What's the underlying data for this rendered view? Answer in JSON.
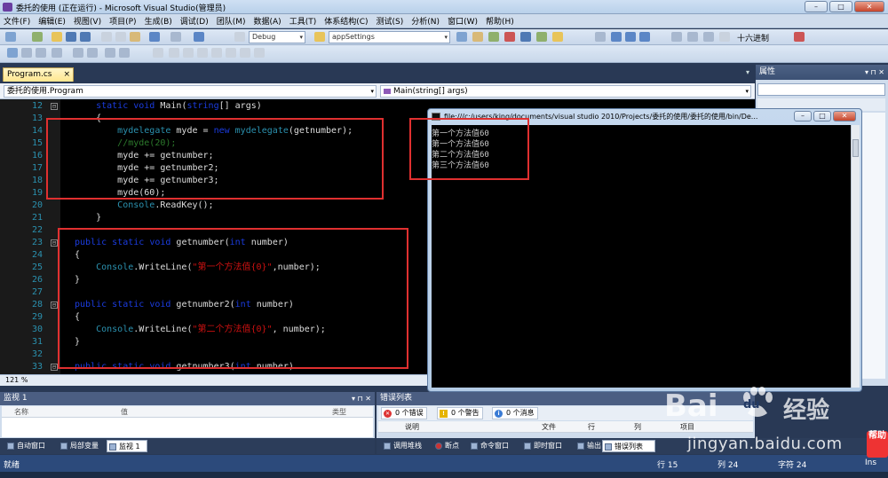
{
  "window": {
    "title": "委托的使用 (正在运行) - Microsoft Visual Studio(管理员)",
    "btn_min": "–",
    "btn_max": "□",
    "btn_close": "✕"
  },
  "menu": [
    "文件(F)",
    "编辑(E)",
    "视图(V)",
    "项目(P)",
    "生成(B)",
    "调试(D)",
    "团队(M)",
    "数据(A)",
    "工具(T)",
    "体系结构(C)",
    "测试(S)",
    "分析(N)",
    "窗口(W)",
    "帮助(H)"
  ],
  "toolbar": {
    "config": "Debug",
    "startup_item": "appSettings",
    "hex_label": "十六进制"
  },
  "editor": {
    "tab_label": "Program.cs",
    "tab_close": "×",
    "nav_class": "委托的使用.Program",
    "nav_method": "Main(string[] args)",
    "zoom": "121 %",
    "lines": [
      {
        "no": "12",
        "fold": "⊟",
        "tokens": [
          {
            "t": "kw",
            "v": "static "
          },
          {
            "t": "kw",
            "v": "void "
          },
          {
            "t": "pl",
            "v": "Main("
          },
          {
            "t": "kw",
            "v": "string"
          },
          {
            "t": "pl",
            "v": "[] args)"
          }
        ],
        "indent": "    "
      },
      {
        "no": "13",
        "fold": "",
        "tokens": [
          {
            "t": "pl",
            "v": "{"
          }
        ],
        "indent": "    "
      },
      {
        "no": "14",
        "fold": "",
        "tokens": [
          {
            "t": "ty",
            "v": "mydelegate"
          },
          {
            "t": "pl",
            "v": " myde = "
          },
          {
            "t": "kw",
            "v": "new "
          },
          {
            "t": "ty",
            "v": "mydelegate"
          },
          {
            "t": "pl",
            "v": "(getnumber);"
          }
        ],
        "indent": "        "
      },
      {
        "no": "15",
        "fold": "",
        "tokens": [
          {
            "t": "cm",
            "v": "//myde(20);"
          }
        ],
        "indent": "        "
      },
      {
        "no": "16",
        "fold": "",
        "tokens": [
          {
            "t": "pl",
            "v": "myde += getnumber;"
          }
        ],
        "indent": "        "
      },
      {
        "no": "17",
        "fold": "",
        "tokens": [
          {
            "t": "pl",
            "v": "myde += getnumber2;"
          }
        ],
        "indent": "        "
      },
      {
        "no": "18",
        "fold": "",
        "tokens": [
          {
            "t": "pl",
            "v": "myde += getnumber3;"
          }
        ],
        "indent": "        "
      },
      {
        "no": "19",
        "fold": "",
        "tokens": [
          {
            "t": "pl",
            "v": "myde(60);"
          }
        ],
        "indent": "        "
      },
      {
        "no": "20",
        "fold": "",
        "tokens": [
          {
            "t": "ty",
            "v": "Console"
          },
          {
            "t": "pl",
            "v": ".ReadKey();"
          }
        ],
        "indent": "        "
      },
      {
        "no": "21",
        "fold": "",
        "tokens": [
          {
            "t": "pl",
            "v": "}"
          }
        ],
        "indent": "    "
      },
      {
        "no": "22",
        "fold": "",
        "tokens": [],
        "indent": ""
      },
      {
        "no": "23",
        "fold": "⊟",
        "tokens": [
          {
            "t": "kw",
            "v": "public "
          },
          {
            "t": "kw",
            "v": "static "
          },
          {
            "t": "kw",
            "v": "void "
          },
          {
            "t": "pl",
            "v": "getnumber("
          },
          {
            "t": "kw",
            "v": "int "
          },
          {
            "t": "pl",
            "v": "number)"
          }
        ],
        "indent": ""
      },
      {
        "no": "24",
        "fold": "",
        "tokens": [
          {
            "t": "pl",
            "v": "{"
          }
        ],
        "indent": ""
      },
      {
        "no": "25",
        "fold": "",
        "tokens": [
          {
            "t": "ty",
            "v": "Console"
          },
          {
            "t": "pl",
            "v": ".WriteLine("
          },
          {
            "t": "str",
            "v": "\"第一个方法值{0}\""
          },
          {
            "t": "pl",
            "v": ",number);"
          }
        ],
        "indent": "    "
      },
      {
        "no": "26",
        "fold": "",
        "tokens": [
          {
            "t": "pl",
            "v": "}"
          }
        ],
        "indent": ""
      },
      {
        "no": "27",
        "fold": "",
        "tokens": [],
        "indent": ""
      },
      {
        "no": "28",
        "fold": "⊟",
        "tokens": [
          {
            "t": "kw",
            "v": "public "
          },
          {
            "t": "kw",
            "v": "static "
          },
          {
            "t": "kw",
            "v": "void "
          },
          {
            "t": "pl",
            "v": "getnumber2("
          },
          {
            "t": "kw",
            "v": "int "
          },
          {
            "t": "pl",
            "v": "number)"
          }
        ],
        "indent": ""
      },
      {
        "no": "29",
        "fold": "",
        "tokens": [
          {
            "t": "pl",
            "v": "{"
          }
        ],
        "indent": ""
      },
      {
        "no": "30",
        "fold": "",
        "tokens": [
          {
            "t": "ty",
            "v": "Console"
          },
          {
            "t": "pl",
            "v": ".WriteLine("
          },
          {
            "t": "str",
            "v": "\"第二个方法值{0}\""
          },
          {
            "t": "pl",
            "v": ", number);"
          }
        ],
        "indent": "    "
      },
      {
        "no": "31",
        "fold": "",
        "tokens": [
          {
            "t": "pl",
            "v": "}"
          }
        ],
        "indent": ""
      },
      {
        "no": "32",
        "fold": "",
        "tokens": [],
        "indent": ""
      },
      {
        "no": "33",
        "fold": "⊟",
        "tokens": [
          {
            "t": "kw",
            "v": "public "
          },
          {
            "t": "kw",
            "v": "static "
          },
          {
            "t": "kw",
            "v": "void "
          },
          {
            "t": "pl",
            "v": "getnumber3("
          },
          {
            "t": "kw",
            "v": "int "
          },
          {
            "t": "pl",
            "v": "number)"
          }
        ],
        "indent": ""
      }
    ]
  },
  "console": {
    "title": "file:///c:/users/king/documents/visual studio 2010/Projects/委托的使用/委托的使用/bin/De...",
    "lines": [
      "第一个方法值60",
      "第一个方法值60",
      "第二个方法值60",
      "第三个方法值60"
    ]
  },
  "properties": {
    "title": "属性",
    "btns": "▾ ⊓ ✕"
  },
  "watch": {
    "title": "监视 1",
    "btns": "▾ ⊓ ✕",
    "cols": [
      "名称",
      "值",
      "类型"
    ]
  },
  "errors": {
    "title": "错误列表",
    "errors_btn": "0 个错误",
    "warnings_btn": "0 个警告",
    "messages_btn": "0 个消息",
    "cols": [
      "说明",
      "文件",
      "行",
      "列",
      "项目"
    ]
  },
  "bottom_tabs_left": [
    "自动窗口",
    "局部变量",
    "监视 1"
  ],
  "bottom_tabs_right": [
    "调用堆栈",
    "断点",
    "命令窗口",
    "即时窗口",
    "输出",
    "错误列表"
  ],
  "status": {
    "ready": "就绪",
    "line": "行 15",
    "col": "列 24",
    "ch": "字符 24",
    "ins": "Ins"
  },
  "watermark": {
    "bai": "Bai",
    "du": "du",
    "cn": "经验",
    "url": "jingyan.baidu.com"
  },
  "help_badge": "帮助",
  "colors": {
    "accent": "#293955",
    "redbox": "#e03030"
  }
}
